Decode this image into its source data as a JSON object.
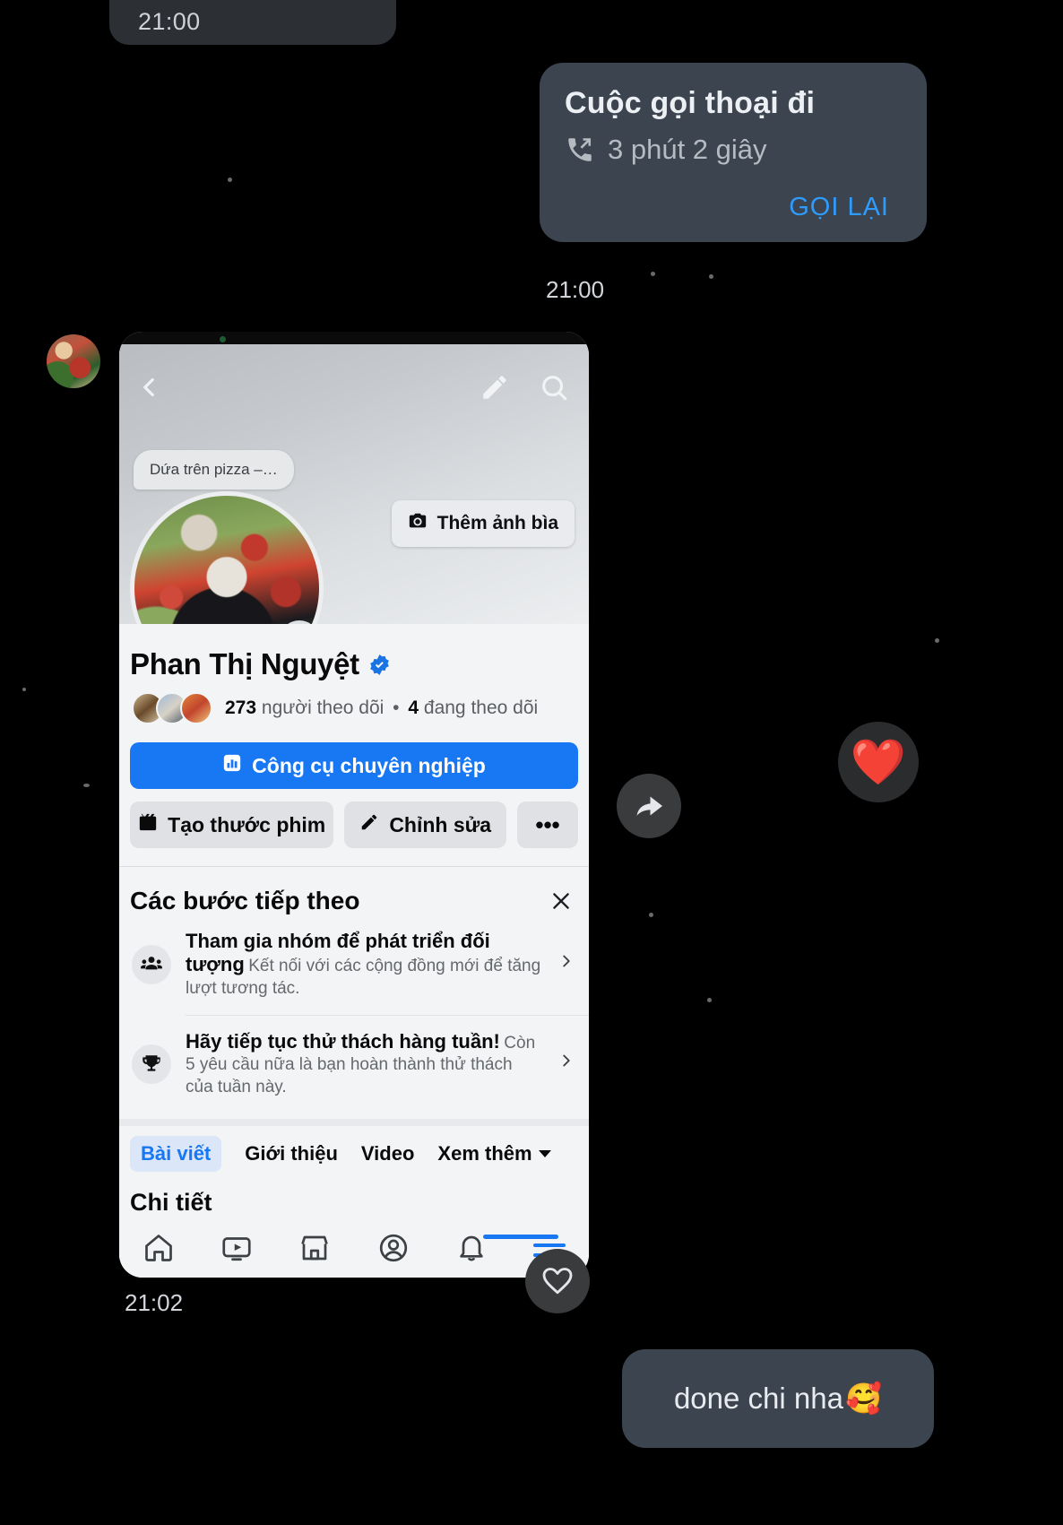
{
  "conversation": {
    "top_timestamp": "21:00",
    "call_message": {
      "title": "Cuộc gọi thoại đi",
      "duration": "3 phút 2 giây",
      "action_label": "GỌI LẠI",
      "timestamp": "21:00",
      "bubble_color": "#3b444f",
      "action_color": "#2e9bff"
    },
    "attachment_timestamp": "21:02",
    "last_message": {
      "text": "done chi nha",
      "emoji": "🥰"
    },
    "reaction_emoji": "❤️",
    "icons": {
      "forward": "forward-icon",
      "like_heart": "heart-outline-icon",
      "call": "outgoing-call-icon"
    }
  },
  "attachment": {
    "app": "facebook-profile-screenshot",
    "topbar": {
      "back": "back-chevron-icon",
      "edit": "pencil-icon",
      "search": "search-icon"
    },
    "note_pill": "Dứa trên pizza –…",
    "add_cover_label": "Thêm ảnh bìa",
    "add_cover_icon": "camera-icon",
    "profile": {
      "name": "Phan Thị Nguyệt",
      "verified": true,
      "followers_count": "273",
      "followers_label": "người theo dõi",
      "following_count": "4",
      "following_label": "đang theo dõi",
      "separator": "•"
    },
    "buttons": {
      "primary": "Công cụ chuyên nghiệp",
      "primary_icon": "chart-icon",
      "reel": "Tạo thước phim",
      "reel_icon": "film-icon",
      "edit": "Chỉnh sửa",
      "edit_icon": "pencil-icon",
      "more": "•••"
    },
    "next_steps": {
      "title": "Các bước tiếp theo",
      "close_icon": "close-icon",
      "items": [
        {
          "icon": "people-group-icon",
          "title": "Tham gia nhóm để phát triển đối tượng",
          "desc": "Kết nối với các cộng đồng mới để tăng lượt tương tác."
        },
        {
          "icon": "trophy-icon",
          "title": "Hãy tiếp tục thử thách hàng tuần!",
          "desc": "Còn 5 yêu cầu nữa là bạn hoàn thành thử thách của tuần này."
        }
      ]
    },
    "tabs": [
      {
        "label": "Bài viết",
        "active": true
      },
      {
        "label": "Giới thiệu",
        "active": false
      },
      {
        "label": "Video",
        "active": false
      },
      {
        "label": "Xem thêm",
        "active": false,
        "has_caret": true
      }
    ],
    "section_heading": "Chi tiết",
    "navbar": [
      {
        "icon": "home-icon",
        "active": false
      },
      {
        "icon": "video-icon",
        "active": false
      },
      {
        "icon": "marketplace-icon",
        "active": false
      },
      {
        "icon": "profile-icon",
        "active": false
      },
      {
        "icon": "bell-icon",
        "active": false
      },
      {
        "icon": "menu-icon",
        "active": true
      }
    ]
  },
  "colors": {
    "background": "#000000",
    "bubble": "#3b444f",
    "accent_blue": "#1877f2",
    "link_blue": "#2e9bff"
  }
}
